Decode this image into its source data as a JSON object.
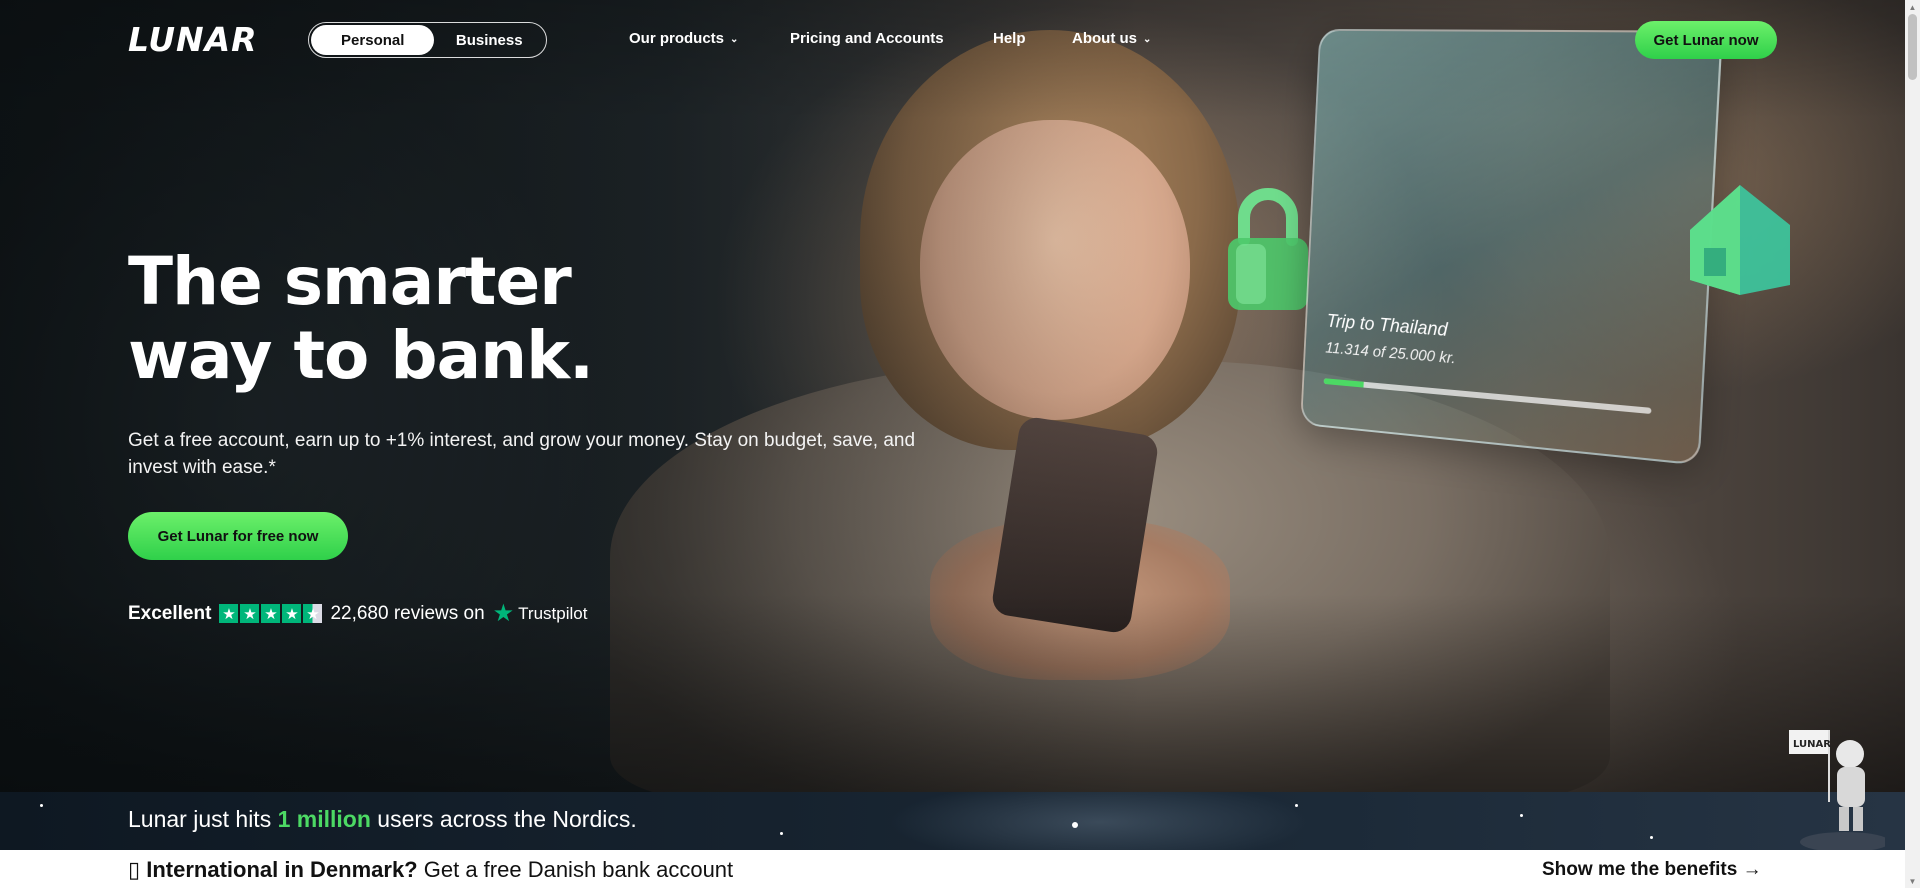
{
  "header": {
    "logo": "LUNAR",
    "segment": {
      "personal": "Personal",
      "business": "Business"
    },
    "nav": {
      "products": "Our products",
      "pricing": "Pricing and Accounts",
      "help": "Help",
      "about": "About us"
    },
    "cta": "Get Lunar now"
  },
  "hero": {
    "headline_line1": "The smarter",
    "headline_line2": "way to bank.",
    "subtext": "Get a free account, earn up to +1% interest, and grow your money. Stay on budget, save, and invest with ease.*",
    "cta": "Get Lunar for free now",
    "trust": {
      "rating_word": "Excellent",
      "stars": 4.5,
      "reviews": "22,680 reviews on",
      "brand": "Trustpilot"
    },
    "goal_card": {
      "title": "Trip to Thailand",
      "amount": "11.314 of 25.000 kr.",
      "progress": 0.13
    }
  },
  "announcement": {
    "prefix": "Lunar just hits",
    "highlight": "1 million",
    "suffix": "users across the Nordics."
  },
  "bottom_bar": {
    "icon_glyph": "▯",
    "bold": "International in Denmark?",
    "text": "Get a free Danish bank account",
    "link": "Show me the benefits →"
  },
  "colors": {
    "accent_green": "#4cd964",
    "trustpilot_green": "#00b67a"
  },
  "icons": [
    "chevron-down-icon",
    "lock-icon",
    "house-icon",
    "trustpilot-star-icon",
    "astronaut-icon",
    "arrow-right-icon"
  ]
}
